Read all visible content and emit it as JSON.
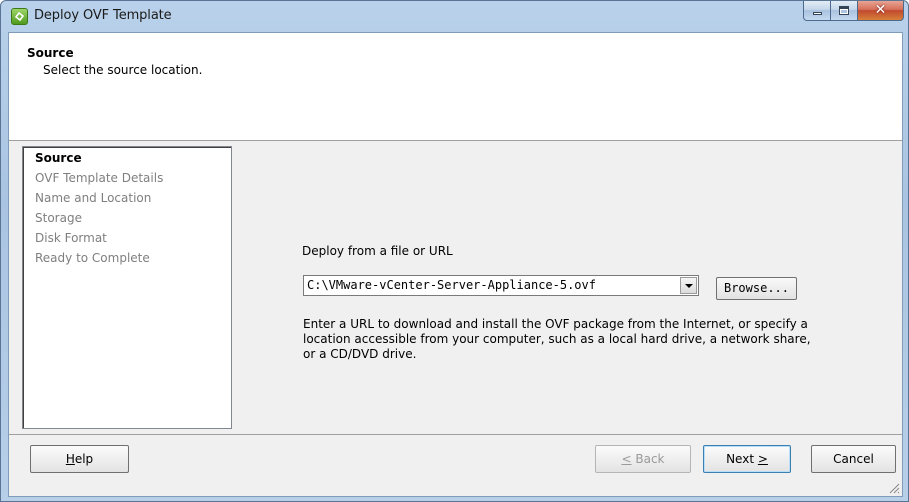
{
  "window": {
    "title": "Deploy OVF Template",
    "icon": "vsphere-deploy-icon"
  },
  "caption_buttons": {
    "minimize": "minimize-icon",
    "maximize": "maximize-icon",
    "close": "close-icon",
    "close_glyph": "✕"
  },
  "header": {
    "title": "Source",
    "subtitle": "Select the source location."
  },
  "steps": [
    {
      "label": "Source",
      "active": true
    },
    {
      "label": "OVF Template Details",
      "active": false
    },
    {
      "label": "Name and Location",
      "active": false
    },
    {
      "label": "Storage",
      "active": false
    },
    {
      "label": "Disk Format",
      "active": false
    },
    {
      "label": "Ready to Complete",
      "active": false
    }
  ],
  "source": {
    "label": "Deploy from a file or URL",
    "path_value": "C:\\VMware-vCenter-Server-Appliance-5.ovf",
    "browse_label": "Browse...",
    "help_text": "Enter a URL to download and install the OVF package from the Internet, or specify a location accessible from your computer, such as a local hard drive, a network share, or a CD/DVD drive."
  },
  "footer": {
    "help_pre": "",
    "help_accel": "H",
    "help_post": "elp",
    "back_accel": "<",
    "back_post": " Back",
    "next_pre": "Next ",
    "next_accel": ">",
    "cancel_label": "Cancel"
  },
  "colors": {
    "frame": "#b9d1ea",
    "close_button": "#c2492f",
    "dialog_background": "#f0f0f0",
    "inactive_step": "#7f7f7f"
  }
}
